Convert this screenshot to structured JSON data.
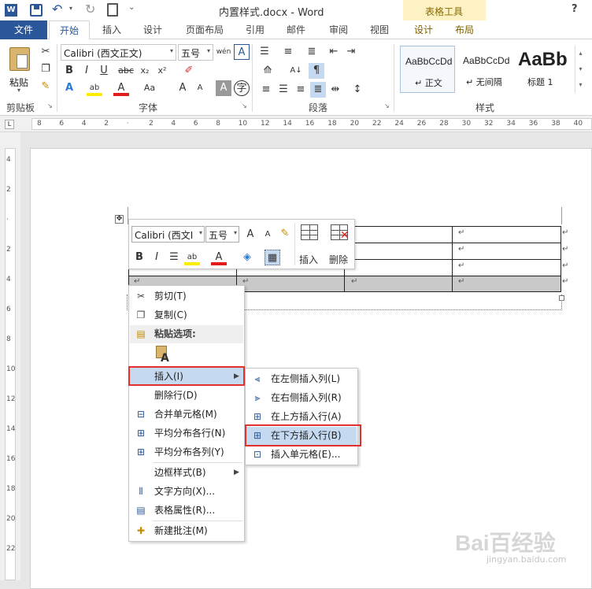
{
  "titlebar": {
    "title": "内置样式.docx - Word",
    "contextual_group": "表格工具",
    "help": "?"
  },
  "tabs": [
    "文件",
    "开始",
    "插入",
    "设计",
    "页面布局",
    "引用",
    "邮件",
    "审阅",
    "视图",
    "设计",
    "布局"
  ],
  "ribbon": {
    "groups": {
      "clipboard": "剪贴板",
      "font": "字体",
      "paragraph": "段落",
      "styles": "样式"
    },
    "paste_label": "粘贴",
    "font_name": "Calibri (西文正文)",
    "font_size": "五号",
    "styles": [
      {
        "preview": "AaBbCcDd",
        "name": "↵ 正文"
      },
      {
        "preview": "AaBbCcDd",
        "name": "↵ 无间隔"
      },
      {
        "preview": "AaBb",
        "name": "标题 1"
      }
    ]
  },
  "ruler": {
    "h_ticks": [
      "8",
      "6",
      "4",
      "2",
      "",
      "2",
      "4",
      "6",
      "8",
      "10",
      "12",
      "14",
      "16",
      "18",
      "20",
      "22",
      "24",
      "26",
      "28",
      "30",
      "32",
      "34",
      "36",
      "38",
      "40"
    ],
    "v_ticks": [
      "4",
      "2",
      "",
      "2",
      "4",
      "6",
      "8",
      "10",
      "12",
      "14",
      "16",
      "18",
      "20",
      "22"
    ]
  },
  "mini_toolbar": {
    "font_name": "Calibri (西文I",
    "font_size": "五号",
    "insert": "插入",
    "delete": "删除"
  },
  "table": {
    "mark": "↵"
  },
  "context_menu": {
    "items": [
      "剪切(T)",
      "复制(C)",
      "粘贴选项:",
      "插入(I)",
      "删除行(D)",
      "合并单元格(M)",
      "平均分布各行(N)",
      "平均分布各列(Y)",
      "边框样式(B)",
      "文字方向(X)...",
      "表格属性(R)...",
      "新建批注(M)"
    ]
  },
  "submenu": {
    "items": [
      "在左侧插入列(L)",
      "在右侧插入列(R)",
      "在上方插入行(A)",
      "在下方插入行(B)",
      "插入单元格(E)..."
    ]
  },
  "watermark": {
    "brand": "Bai百经验",
    "url": "jingyan.baidu.com"
  }
}
